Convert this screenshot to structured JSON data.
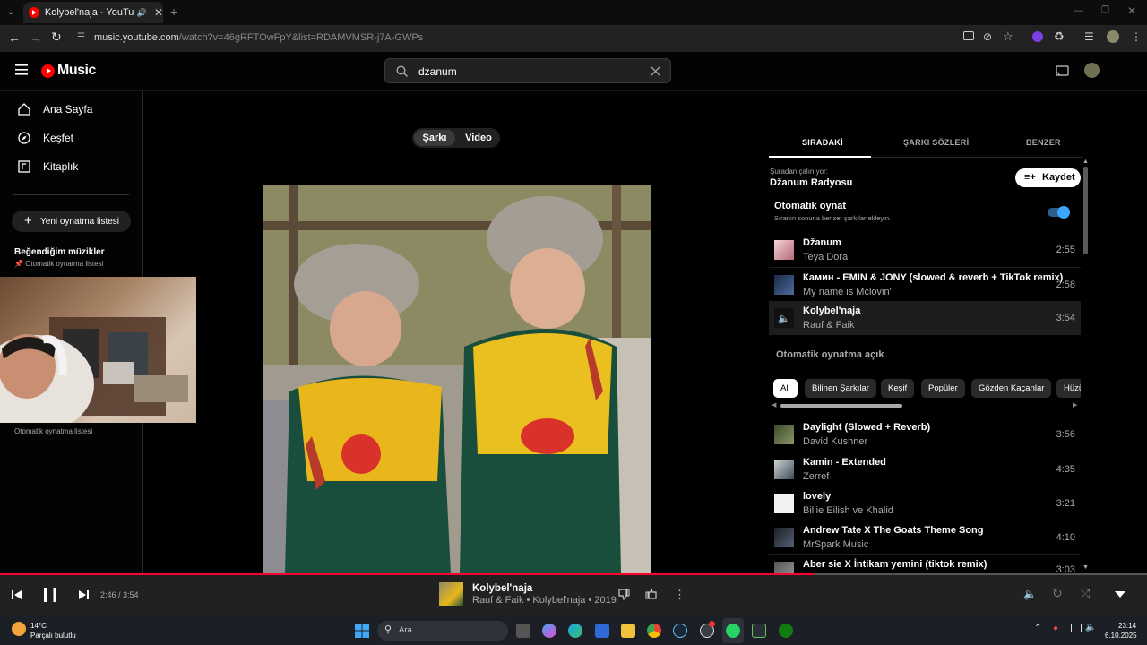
{
  "browser": {
    "tab_title": "Kolybel'naja - YouTube Music",
    "url_host": "music.youtube.com",
    "url_rest": "/watch?v=46gRFTOwFpY&list=RDAMVMSR-j7A-GWPs"
  },
  "header": {
    "logo_text": "Music",
    "search_value": "dzanum"
  },
  "sidebar": {
    "nav": [
      {
        "label": "Ana Sayfa",
        "icon": "home-icon"
      },
      {
        "label": "Keşfet",
        "icon": "compass-icon"
      },
      {
        "label": "Kitaplık",
        "icon": "library-icon"
      }
    ],
    "new_playlist": "Yeni oynatma listesi",
    "liked_title": "Beğendiğim müzikler",
    "liked_sub": "Otomatik oynatma listesi",
    "item2_sub": "Otomatik oynatma listesi"
  },
  "main": {
    "toggle_song": "Şarkı",
    "toggle_video": "Video"
  },
  "panel": {
    "tabs": [
      "SIRADAKİ",
      "ŞARKI SÖZLERİ",
      "BENZER"
    ],
    "playing_from_label": "Şuradan çalınıyor:",
    "playing_from": "Džanum Radyosu",
    "save_label": "Kaydet",
    "autoplay_title": "Otomatik oynat",
    "autoplay_desc": "Sıranın sonuna benzer şarkılar ekleyin.",
    "queue": [
      {
        "title": "Džanum",
        "artist": "Teya Dora",
        "duration": "2:55"
      },
      {
        "title": "Камин - EMIN & JONY (slowed & reverb + TikTok remix)",
        "artist": "My name is Mclovin'",
        "duration": "2:58"
      },
      {
        "title": "Kolybel'naja",
        "artist": "Rauf & Faik",
        "duration": "3:54"
      }
    ],
    "autoplay_on_label": "Otomatik oynatma açık",
    "chips": [
      "All",
      "Bilinen Şarkılar",
      "Keşif",
      "Popüler",
      "Gözden Kaçanlar",
      "Hüzü"
    ],
    "autoplay_queue": [
      {
        "title": "Daylight (Slowed + Reverb)",
        "artist": "David Kushner",
        "duration": "3:56"
      },
      {
        "title": "Kamin - Extended",
        "artist": "Zerref",
        "duration": "4:35"
      },
      {
        "title": "lovely",
        "artist": "Billie Eilish ve Khalid",
        "duration": "3:21"
      },
      {
        "title": "Andrew Tate X The Goats Theme Song",
        "artist": "MrSpark Music",
        "duration": "4:10"
      },
      {
        "title": "Aber sie X İntikam yemini (tiktok remix)",
        "artist": "",
        "duration": "3:03"
      }
    ]
  },
  "player": {
    "time": "2:46 / 3:54",
    "progress": 0.709,
    "title": "Kolybel'naja",
    "subtitle": "Rauf & Faik • Kolybel'naja • 2019"
  },
  "taskbar": {
    "temp": "14°C",
    "weather": "Parçalı bulutlu",
    "search": "Ara",
    "time": "23:14",
    "date": "6.10.2025"
  },
  "colors": {
    "accent": "#ff0033",
    "toggle_blue": "#3ea6ff"
  }
}
